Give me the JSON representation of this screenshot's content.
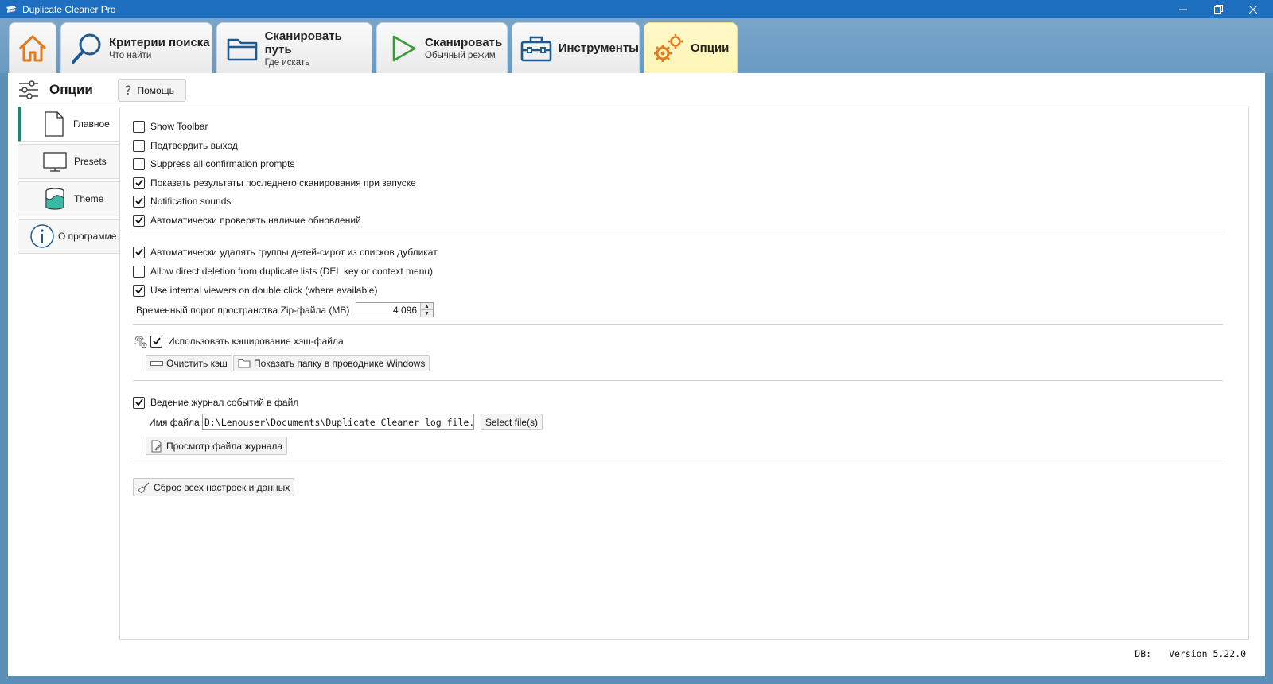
{
  "window": {
    "title": "Duplicate Cleaner Pro"
  },
  "ribbon": {
    "tabs": [
      {
        "id": "home",
        "label": "",
        "sub": ""
      },
      {
        "id": "criteria",
        "label": "Критерии поиска",
        "sub": "Что найти"
      },
      {
        "id": "scan-path",
        "label": "Сканировать путь",
        "sub": "Где искать"
      },
      {
        "id": "scan",
        "label": "Сканировать",
        "sub": "Обычный режим"
      },
      {
        "id": "tools",
        "label": "Инструменты",
        "sub": ""
      },
      {
        "id": "options",
        "label": "Опции",
        "sub": ""
      }
    ]
  },
  "options": {
    "title": "Опции",
    "help_label": "Помощь",
    "side": [
      {
        "label": "Главное"
      },
      {
        "label": "Presets"
      },
      {
        "label": "Theme"
      },
      {
        "label": "О программе"
      }
    ],
    "general": {
      "show_toolbar": {
        "label": "Show Toolbar",
        "checked": false
      },
      "confirm_exit": {
        "label": "Подтвердить выход",
        "checked": false
      },
      "suppress_prompts": {
        "label": "Suppress all confirmation prompts",
        "checked": false
      },
      "show_last_results": {
        "label": "Показать результаты последнего сканирования при запуске",
        "checked": true
      },
      "notification_sounds": {
        "label": "Notification sounds",
        "checked": true
      },
      "auto_updates": {
        "label": "Автоматически проверять наличие обновлений",
        "checked": true
      },
      "auto_remove_orphans": {
        "label": "Автоматически удалять группы детей-сирот из списков дубликат",
        "checked": true
      },
      "allow_direct_delete": {
        "label": "Allow direct deletion from duplicate lists (DEL key or context menu)",
        "checked": false
      },
      "internal_viewers": {
        "label": "Use internal viewers on double click (where available)",
        "checked": true
      },
      "zip_threshold_label": "Временный порог пространства Zip-файла (MB)",
      "zip_threshold_value": "4 096",
      "hash_cache": {
        "label": "Использовать кэширование хэш-файла",
        "checked": true
      },
      "clear_cache_label": "Очистить кэш",
      "show_folder_label": "Показать папку в проводнике Windows",
      "log_to_file": {
        "label": "Ведение журнал событий в файл",
        "checked": true
      },
      "file_name_label": "Имя файла",
      "file_name_value": "D:\\Lenouser\\Documents\\Duplicate Cleaner log file.txt",
      "select_files_label": "Select file(s)",
      "view_log_label": "Просмотр файла журнала",
      "reset_all_label": "Сброс всех настроек и данных"
    }
  },
  "status": {
    "db_label": "DB:",
    "version": "Version 5.22.0"
  }
}
